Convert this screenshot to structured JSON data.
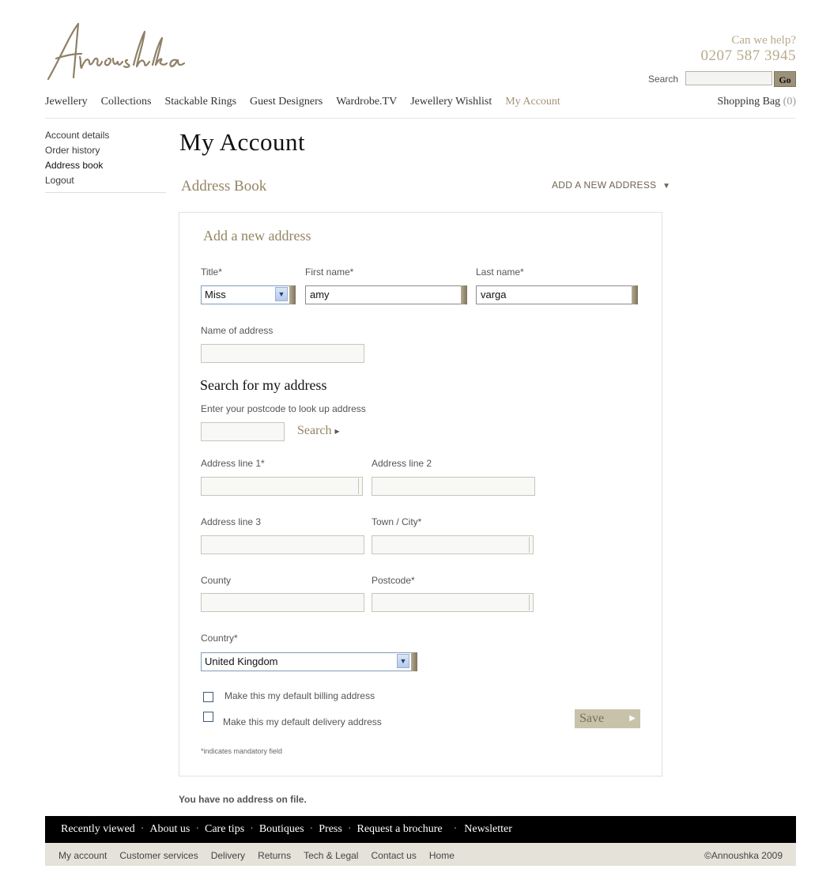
{
  "brand": {
    "logo_text": "Annoushka"
  },
  "help": {
    "question": "Can we help?",
    "phone": "0207 587 3945"
  },
  "search": {
    "label": "Search",
    "placeholder": "",
    "go_label": "Go"
  },
  "nav": {
    "items": [
      "Jewellery",
      "Collections",
      "Stackable Rings",
      "Guest Designers",
      "Wardrobe.TV",
      "Jewellery Wishlist",
      "My Account"
    ],
    "active": "My Account",
    "bag_label": "Shopping Bag",
    "bag_count": "(0)"
  },
  "sidebar": {
    "items": [
      "Account details",
      "Order history",
      "Address book",
      "Logout"
    ],
    "current": "Address book"
  },
  "page": {
    "title": "My Account",
    "section": "Address Book",
    "add_link": "ADD A NEW ADDRESS",
    "add_link_arrow": "▼"
  },
  "form": {
    "heading": "Add a new address",
    "title_label": "Title*",
    "title_value": "Miss",
    "first_name_label": "First name*",
    "first_name_value": "amy",
    "last_name_label": "Last name*",
    "last_name_value": "varga",
    "address_name_label": "Name of address",
    "address_name_value": "",
    "lookup_heading": "Search for my address",
    "lookup_hint": "Enter your postcode to look up address",
    "lookup_value": "",
    "lookup_button": "Search",
    "lookup_arrow": "▸",
    "line1_label": "Address line 1*",
    "line2_label": "Address line 2",
    "line3_label": "Address line 3",
    "town_label": "Town / City*",
    "county_label": "County",
    "postcode_label": "Postcode*",
    "country_label": "Country*",
    "country_value": "United Kingdom",
    "default_billing_label": "Make this my default billing address",
    "default_delivery_label": "Make this my default delivery address",
    "default_billing_checked": false,
    "default_delivery_checked": false,
    "save_label": "Save",
    "save_arrow": "▶",
    "mandatory_note": "*indicates mandatory field"
  },
  "no_address_text": "You have no address on file.",
  "footer": {
    "primary": [
      "Recently viewed",
      "About us",
      "Care tips",
      "Boutiques",
      "Press",
      "Request a brochure",
      "Newsletter"
    ],
    "separator": "·",
    "secondary": [
      "My account",
      "Customer services",
      "Delivery",
      "Returns",
      "Tech & Legal",
      "Contact us",
      "Home"
    ],
    "copyright": "©Annoushka 2009"
  },
  "colors": {
    "accent": "#948463",
    "footer_dark": "#000000",
    "footer_light": "#e5e2d9"
  }
}
